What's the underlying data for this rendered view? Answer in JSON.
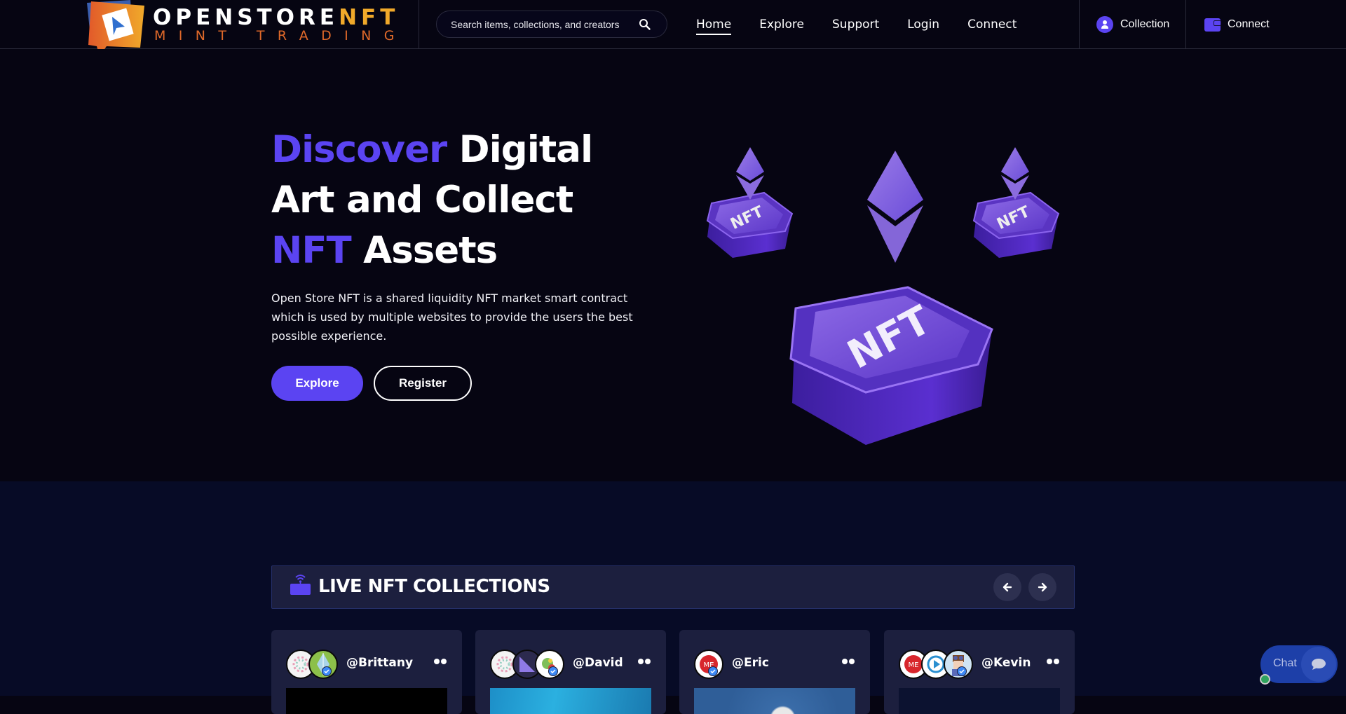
{
  "brand": {
    "name_main": "OPENSTORE",
    "name_accent": "NFT",
    "tagline": "MINT TRADING",
    "colors": {
      "accent": "#5b44f2",
      "logo_orange": "#e0692a",
      "logo_gold": "#f0a92a"
    }
  },
  "header": {
    "search": {
      "placeholder": "Search items, collections, and creators",
      "value": "",
      "icon": "search-icon"
    },
    "nav": [
      {
        "label": "Home",
        "active": true
      },
      {
        "label": "Explore",
        "active": false
      },
      {
        "label": "Support",
        "active": false
      },
      {
        "label": "Login",
        "active": false
      },
      {
        "label": "Connect",
        "active": false
      }
    ],
    "collection_button": {
      "label": "Collection",
      "icon": "user-icon"
    },
    "connect_button": {
      "label": "Connect",
      "icon": "wallet-icon"
    }
  },
  "hero": {
    "title_part1": "Discover",
    "title_part2": " Digital Art and Collect ",
    "title_part3": "NFT",
    "title_part4": " Assets",
    "description": "Open Store NFT is a shared liquidity NFT market smart contract which is used by multiple websites to provide the users the best possible experience.",
    "primary_button": "Explore",
    "secondary_button": "Register",
    "art_label": "NFT"
  },
  "live": {
    "title": "LIVE NFT COLLECTIONS",
    "prev_icon": "arrow-left-icon",
    "next_icon": "arrow-right-icon",
    "cards": [
      {
        "handle": "@Brittany",
        "avatars": 2,
        "verified": true
      },
      {
        "handle": "@David",
        "avatars": 3,
        "verified": true
      },
      {
        "handle": "@Eric",
        "avatars": 1,
        "verified": true
      },
      {
        "handle": "@Kevin",
        "avatars": 3,
        "verified": true
      }
    ]
  },
  "chat": {
    "label": "Chat",
    "status": "online"
  }
}
